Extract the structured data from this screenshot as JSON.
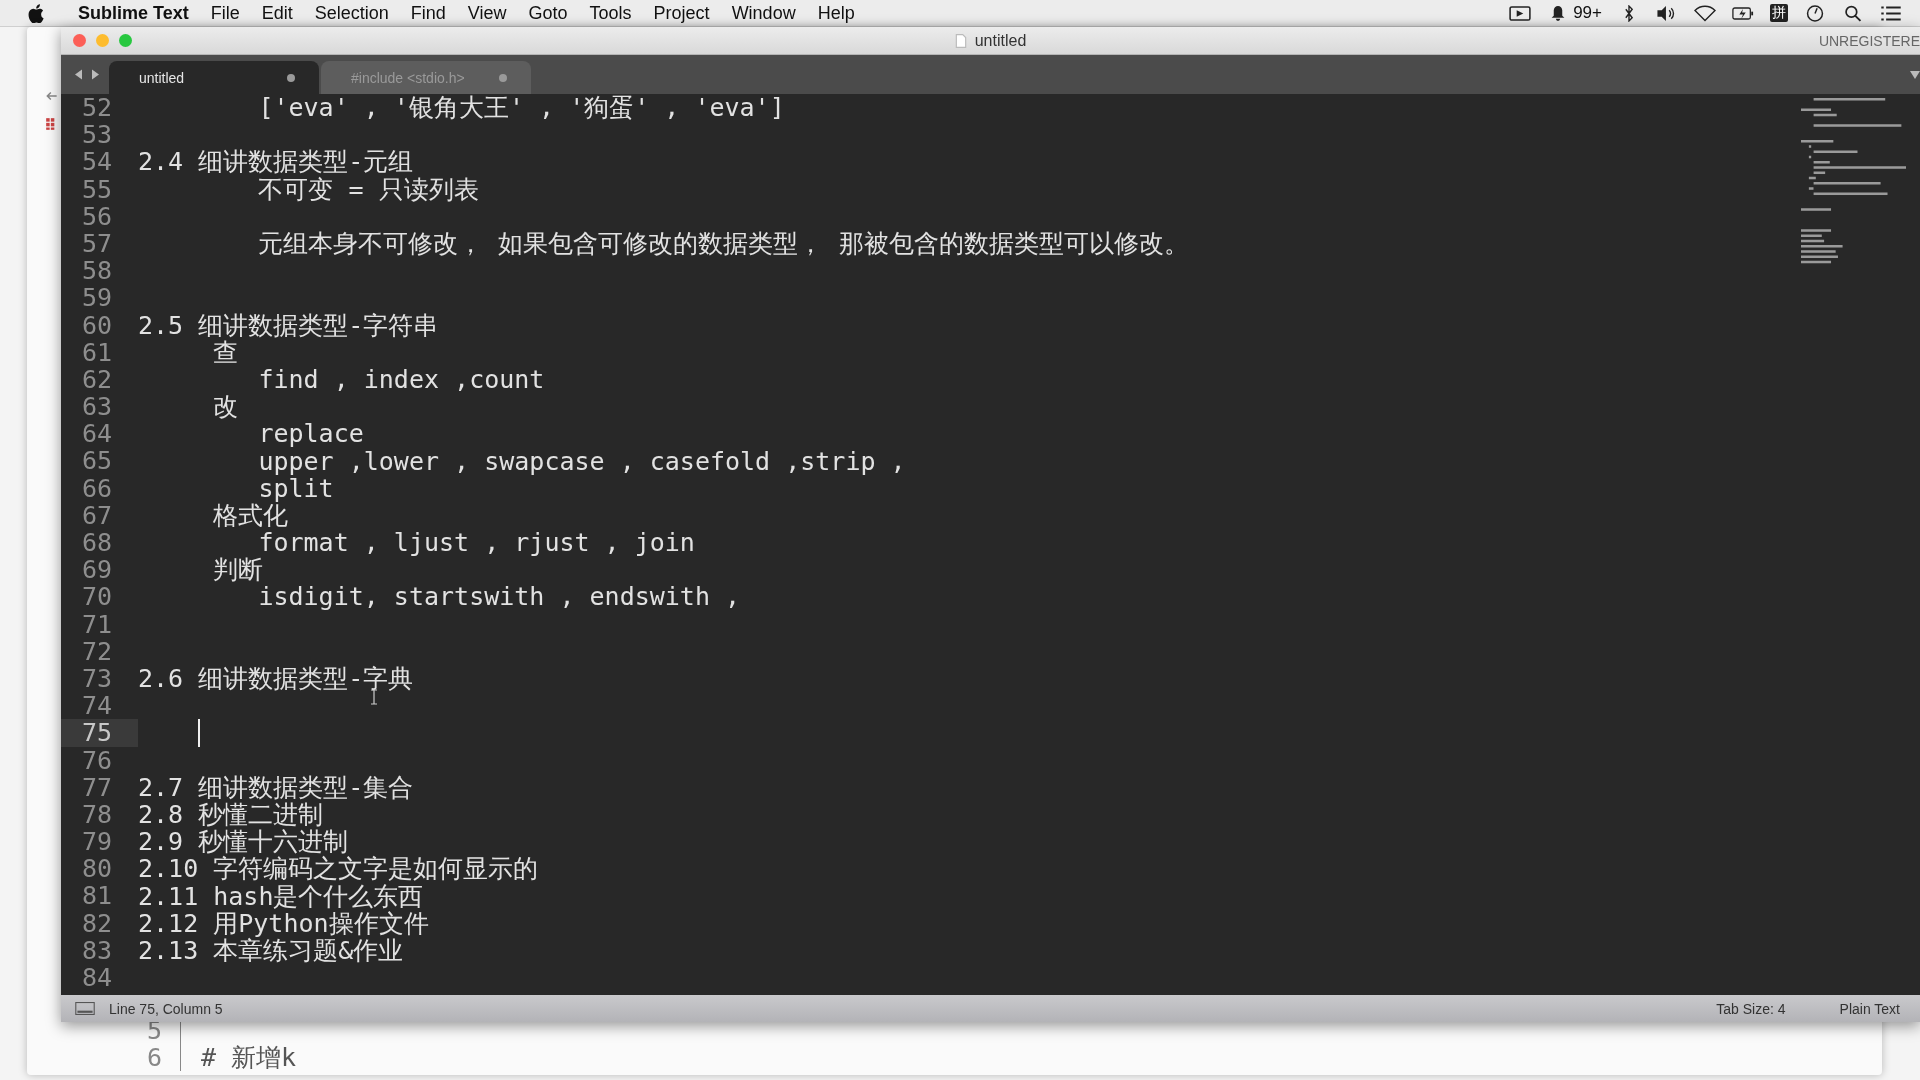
{
  "menubar": {
    "app": "Sublime Text",
    "menus": [
      "File",
      "Edit",
      "Selection",
      "Find",
      "View",
      "Goto",
      "Tools",
      "Project",
      "Window",
      "Help"
    ],
    "notification_count": "99+",
    "input_method": "拼"
  },
  "background_window": {
    "lines": [
      {
        "number": "5"
      },
      {
        "number": "6",
        "text": "# 新增k"
      }
    ]
  },
  "window": {
    "title": "untitled",
    "registration": "UNREGISTERE"
  },
  "tabs": [
    {
      "label": "untitled",
      "selected": true,
      "modified": true
    },
    {
      "label": "#include <stdio.h>",
      "selected": false,
      "modified": true
    }
  ],
  "editor": {
    "lines": [
      {
        "number": "52",
        "text": "        ['eva' , '银角大王' , '狗蛋' , 'eva']",
        "current": false
      },
      {
        "number": "53",
        "current": false
      },
      {
        "number": "54",
        "text": "2.4 细讲数据类型-元组",
        "current": false
      },
      {
        "number": "55",
        "text": "        不可变 = 只读列表",
        "current": false
      },
      {
        "number": "56",
        "current": false
      },
      {
        "number": "57",
        "text": "        元组本身不可修改， 如果包含可修改的数据类型， 那被包含的数据类型可以修改。",
        "current": false
      },
      {
        "number": "58",
        "current": false
      },
      {
        "number": "59",
        "current": false
      },
      {
        "number": "60",
        "text": "2.5 细讲数据类型-字符串",
        "current": false
      },
      {
        "number": "61",
        "text": "     查",
        "current": false
      },
      {
        "number": "62",
        "text": "        find , index ,count",
        "current": false
      },
      {
        "number": "63",
        "text": "     改",
        "current": false
      },
      {
        "number": "64",
        "text": "        replace",
        "current": false
      },
      {
        "number": "65",
        "text": "        upper ,lower , swapcase , casefold ,strip ,",
        "current": false
      },
      {
        "number": "66",
        "text": "        split",
        "current": false
      },
      {
        "number": "67",
        "text": "     格式化",
        "current": false
      },
      {
        "number": "68",
        "text": "        format , ljust , rjust , join",
        "current": false
      },
      {
        "number": "69",
        "text": "     判断",
        "current": false
      },
      {
        "number": "70",
        "text": "        isdigit, startswith , endswith ,",
        "current": false
      },
      {
        "number": "71",
        "current": false
      },
      {
        "number": "72",
        "current": false
      },
      {
        "number": "73",
        "text": "2.6 细讲数据类型-字典",
        "current": false
      },
      {
        "number": "74",
        "current": false
      },
      {
        "number": "75",
        "current": true
      },
      {
        "number": "76",
        "current": false
      },
      {
        "number": "77",
        "text": "2.7 细讲数据类型-集合",
        "current": false
      },
      {
        "number": "78",
        "text": "2.8 秒懂二进制",
        "current": false
      },
      {
        "number": "79",
        "text": "2.9 秒懂十六进制",
        "current": false
      },
      {
        "number": "80",
        "text": "2.10 字符编码之文字是如何显示的",
        "current": false
      },
      {
        "number": "81",
        "text": "2.11 hash是个什么东西",
        "current": false
      },
      {
        "number": "82",
        "text": "2.12 用Python操作文件",
        "current": false
      },
      {
        "number": "83",
        "text": "2.13 本章练习题&作业",
        "current": false
      },
      {
        "number": "84",
        "current": false
      }
    ]
  },
  "status_bar": {
    "position": "Line 75, Column 5",
    "tab_size": "Tab Size: 4",
    "syntax": "Plain Text"
  }
}
